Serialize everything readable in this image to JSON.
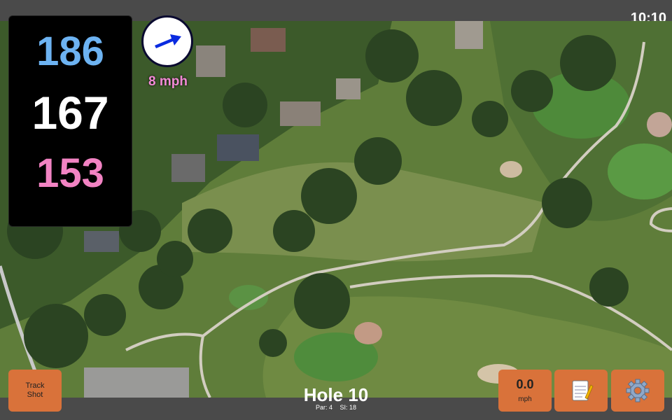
{
  "status": {
    "time": "10:10"
  },
  "distances": {
    "front": "186",
    "middle": "167",
    "back": "153"
  },
  "wind": {
    "speed": "8 mph",
    "direction_icon": "arrow-right-icon"
  },
  "hole": {
    "title": "Hole 10",
    "par": "Par: 4",
    "si": "SI: 18"
  },
  "buttons": {
    "track_shot": "Track\nShot",
    "speed_value": "0.0",
    "speed_unit": "mph",
    "notes_icon": "notepad-icon",
    "settings_icon": "gear-icon"
  },
  "colors": {
    "front": "#6db3f2",
    "middle": "#ffffff",
    "back": "#f283c3",
    "button": "#d9723a",
    "wind_text": "#f28ad6"
  }
}
